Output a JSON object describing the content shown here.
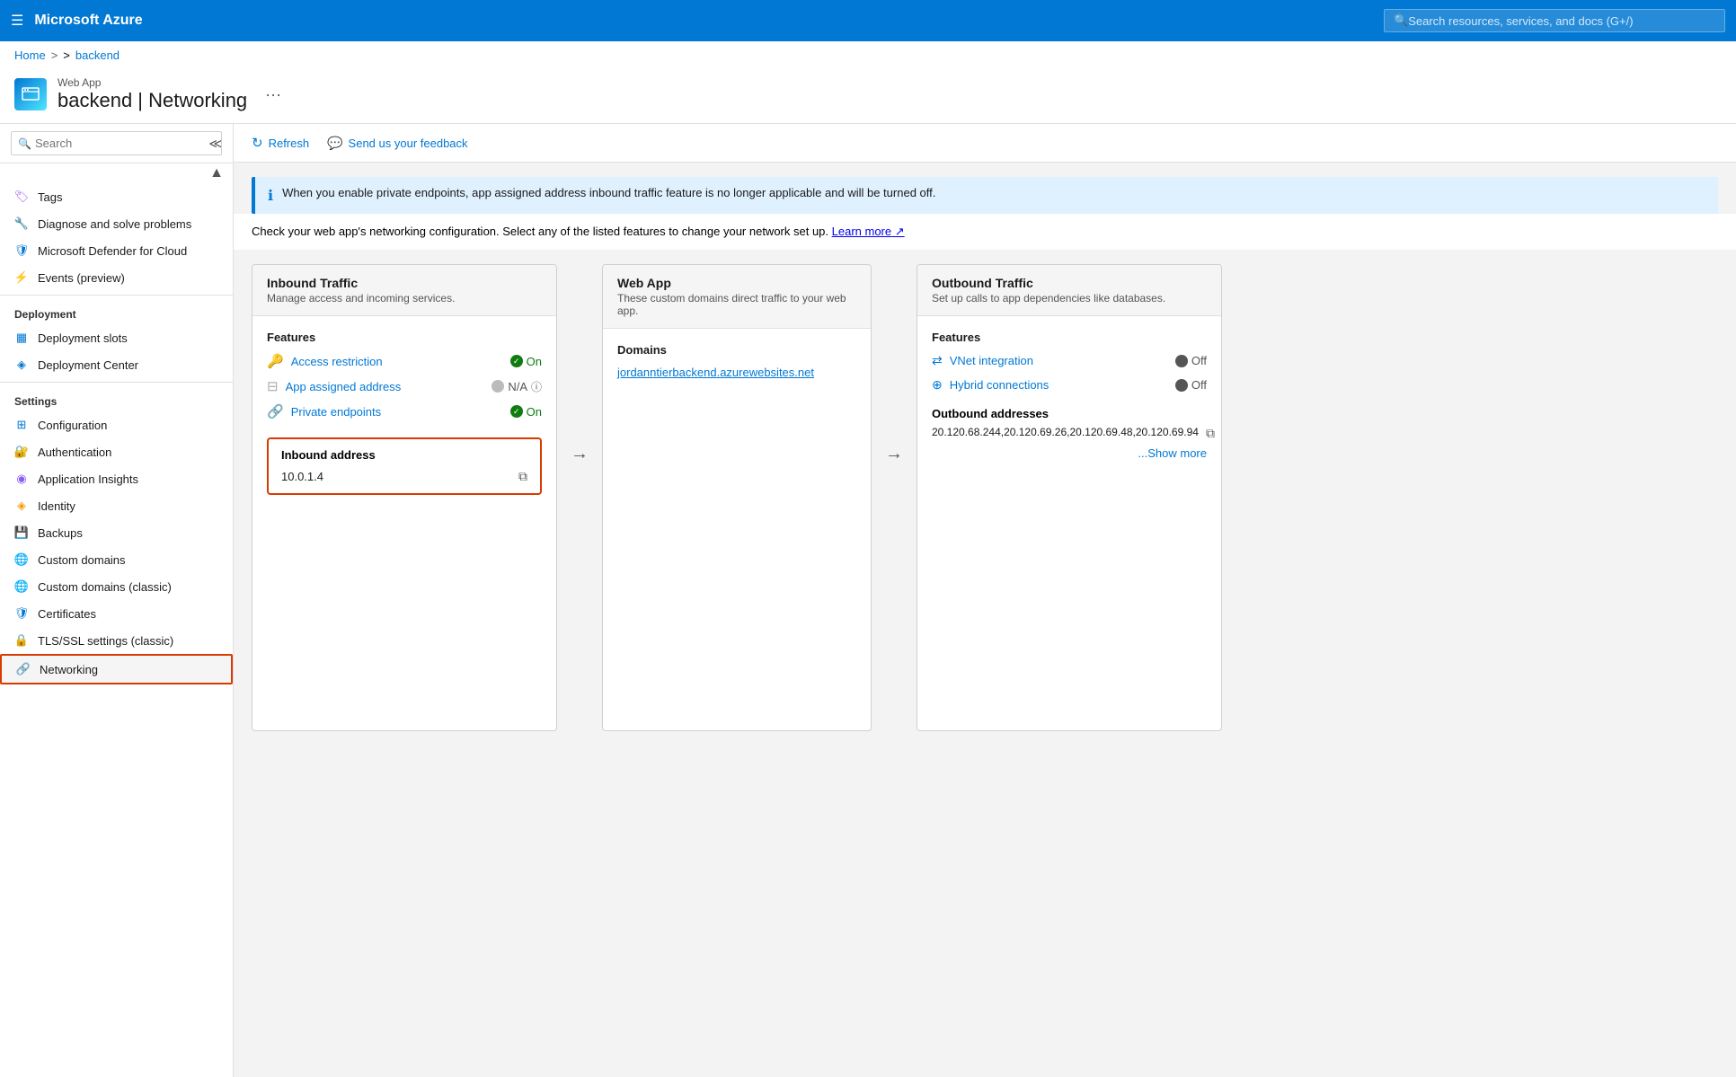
{
  "topNav": {
    "hamburger": "☰",
    "brand": "Microsoft Azure",
    "searchPlaceholder": "Search resources, services, and docs (G+/)"
  },
  "breadcrumb": {
    "home": "Home",
    "backend": "backend"
  },
  "pageHeader": {
    "subtitle": "Web App",
    "title": "backend | Networking",
    "ellipsis": "···"
  },
  "toolbar": {
    "refresh": "Refresh",
    "feedback": "Send us your feedback"
  },
  "infoBanner": {
    "text": "When you enable private endpoints, app assigned address inbound traffic feature is no longer applicable and will be turned off."
  },
  "description": {
    "text": "Check your web app's networking configuration. Select any of the listed features to change your network set up.",
    "learnMore": "Learn more"
  },
  "sidebar": {
    "searchPlaceholder": "Search",
    "items": [
      {
        "label": "Tags",
        "icon": "tag"
      },
      {
        "label": "Diagnose and solve problems",
        "icon": "wrench"
      },
      {
        "label": "Microsoft Defender for Cloud",
        "icon": "shield"
      },
      {
        "label": "Events (preview)",
        "icon": "bolt"
      }
    ],
    "sections": [
      {
        "label": "Deployment",
        "items": [
          {
            "label": "Deployment slots",
            "icon": "slot"
          },
          {
            "label": "Deployment Center",
            "icon": "center"
          }
        ]
      },
      {
        "label": "Settings",
        "items": [
          {
            "label": "Configuration",
            "icon": "config"
          },
          {
            "label": "Authentication",
            "icon": "auth"
          },
          {
            "label": "Application Insights",
            "icon": "insights"
          },
          {
            "label": "Identity",
            "icon": "identity"
          },
          {
            "label": "Backups",
            "icon": "backup"
          },
          {
            "label": "Custom domains",
            "icon": "domain"
          },
          {
            "label": "Custom domains (classic)",
            "icon": "domain-classic"
          },
          {
            "label": "Certificates",
            "icon": "cert"
          },
          {
            "label": "TLS/SSL settings (classic)",
            "icon": "tls"
          },
          {
            "label": "Networking",
            "icon": "network",
            "active": true
          }
        ]
      }
    ]
  },
  "inboundTraffic": {
    "title": "Inbound Traffic",
    "subtitle": "Manage access and incoming services.",
    "featuresLabel": "Features",
    "features": [
      {
        "name": "Access restriction",
        "status": "On",
        "statusType": "on"
      },
      {
        "name": "App assigned address",
        "status": "N/A",
        "statusType": "na"
      },
      {
        "name": "Private endpoints",
        "status": "On",
        "statusType": "on"
      }
    ],
    "inboundAddress": {
      "label": "Inbound address",
      "value": "10.0.1.4"
    }
  },
  "webApp": {
    "title": "Web App",
    "subtitle": "These custom domains direct traffic to your web app.",
    "domainsLabel": "Domains",
    "domain": "jordanntierbackend.azurewebsites.net"
  },
  "outboundTraffic": {
    "title": "Outbound Traffic",
    "subtitle": "Set up calls to app dependencies like databases.",
    "featuresLabel": "Features",
    "features": [
      {
        "name": "VNet integration",
        "status": "Off",
        "statusType": "off"
      },
      {
        "name": "Hybrid connections",
        "status": "Off",
        "statusType": "off"
      }
    ],
    "outboundAddresses": {
      "label": "Outbound addresses",
      "value": "20.120.68.244,20.120.69.26,20.120.69.48,20.120.69.94",
      "showMore": "...Show more"
    }
  }
}
